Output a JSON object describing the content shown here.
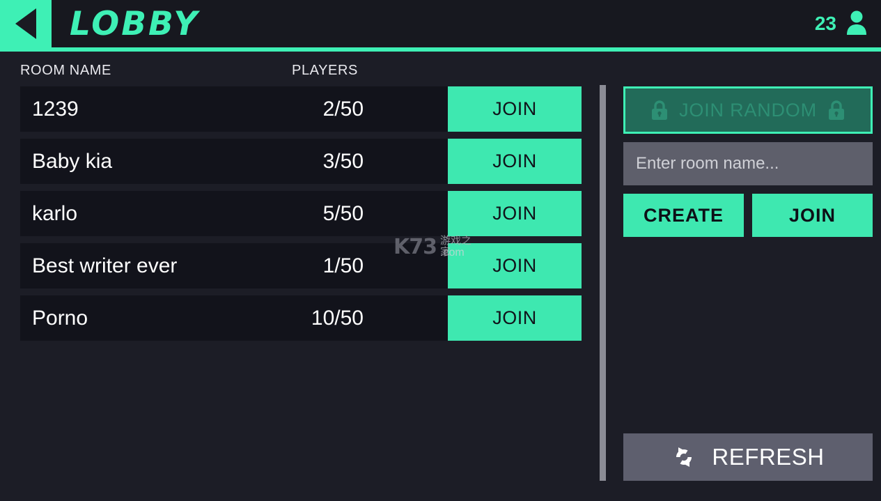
{
  "header": {
    "back_icon": "back-triangle-icon",
    "title": "LOBBY",
    "player_count": "23",
    "user_icon": "person-icon",
    "accent_color": "#3ef0b5",
    "background_color": "#17181f"
  },
  "list": {
    "columns": {
      "room_name": "ROOM NAME",
      "players": "PLAYERS"
    },
    "rows": [
      {
        "name": "1239",
        "players": "2/50",
        "join_label": "JOIN"
      },
      {
        "name": "Baby kia",
        "players": "3/50",
        "join_label": "JOIN"
      },
      {
        "name": "karlo",
        "players": "5/50",
        "join_label": "JOIN"
      },
      {
        "name": "Best writer ever",
        "players": "1/50",
        "join_label": "JOIN"
      },
      {
        "name": "Porno",
        "players": "10/50",
        "join_label": "JOIN"
      }
    ]
  },
  "panel": {
    "join_random": {
      "label": "JOIN RANDOM",
      "left_icon": "lock-icon",
      "right_icon": "lock-icon",
      "locked": true,
      "border_color": "#3ef0b5",
      "fill_color": "#226b59",
      "text_color": "#2d8f74"
    },
    "room_input": {
      "value": "",
      "placeholder": "Enter room name...",
      "background_color": "#5e5f6b"
    },
    "create_label": "CREATE",
    "join_label": "JOIN",
    "refresh": {
      "label": "REFRESH",
      "icon": "refresh-icon",
      "background_color": "#5e5f6e"
    }
  },
  "watermark": {
    "brand": "K73",
    "chinese": "游戏之家",
    "domain": ".com"
  }
}
